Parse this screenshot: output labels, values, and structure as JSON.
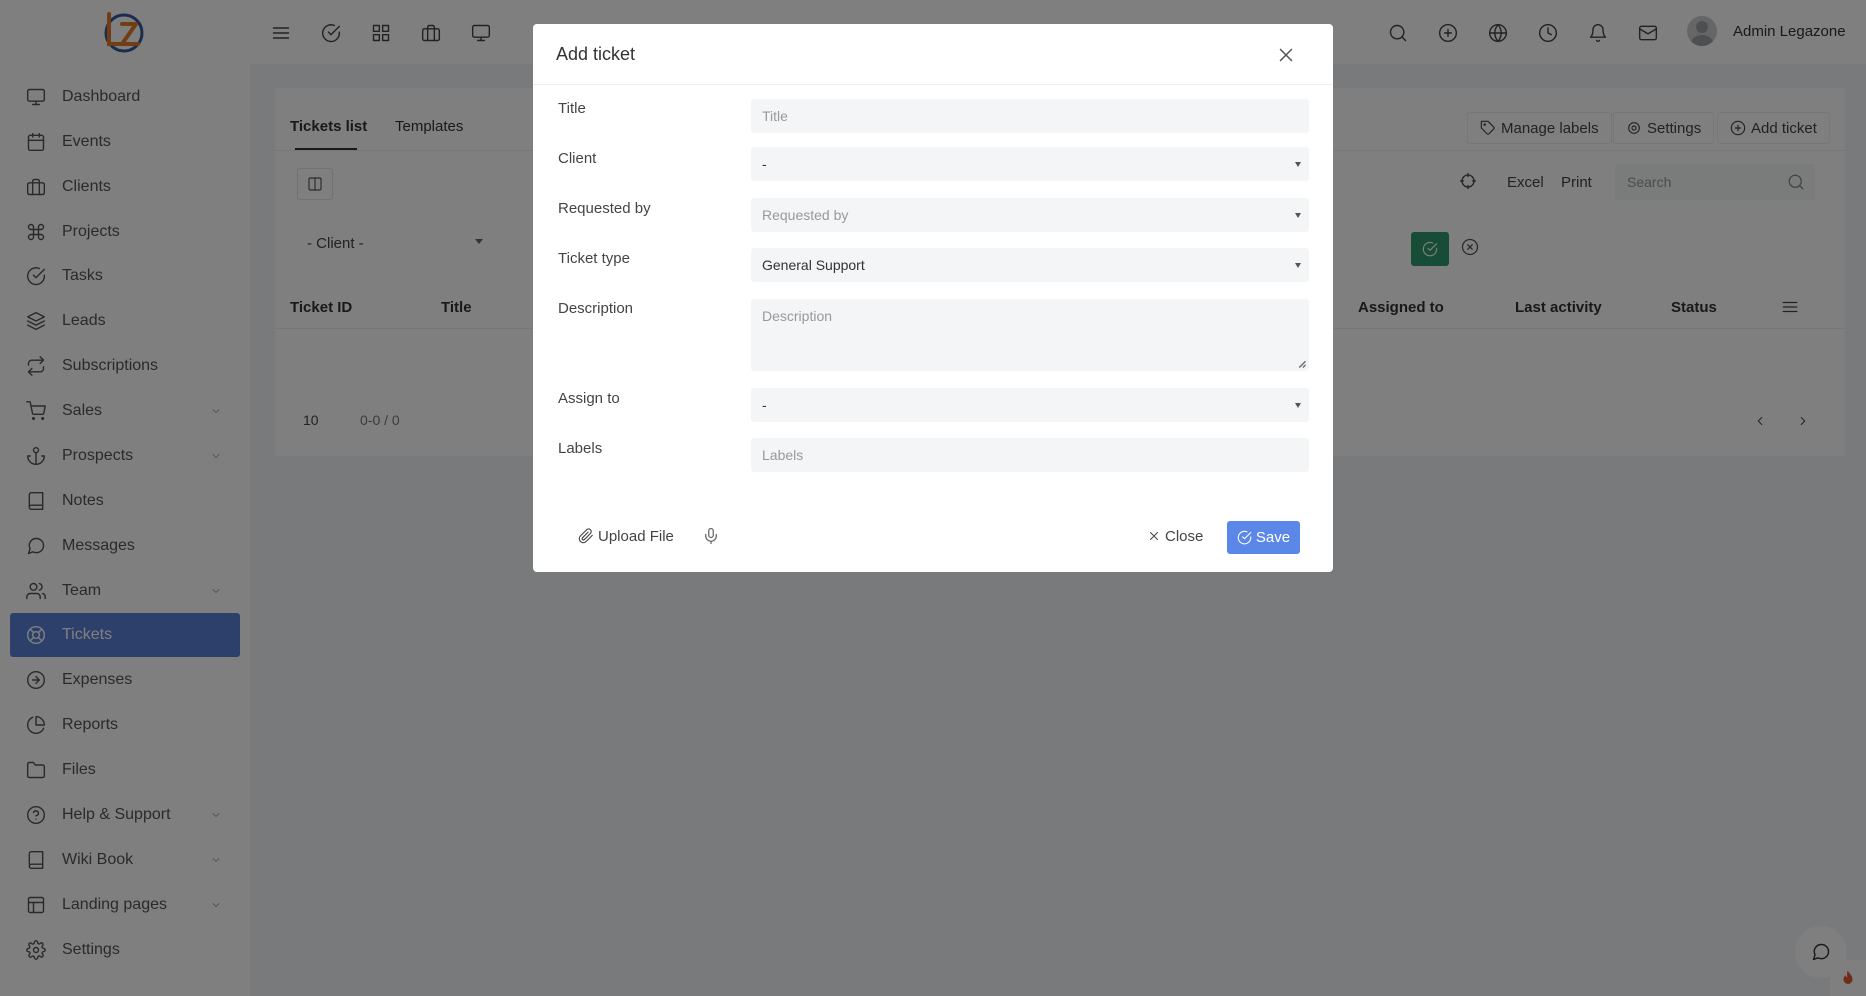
{
  "header": {
    "user_name": "Admin Legazone",
    "icons": [
      "menu-icon",
      "check-circle-icon",
      "grid-icon",
      "briefcase-icon",
      "monitor-icon",
      "search-icon",
      "plus-circle-icon",
      "globe-icon",
      "clock-icon",
      "bell-icon",
      "mail-icon"
    ]
  },
  "sidebar": {
    "items": [
      {
        "label": "Dashboard",
        "icon": "monitor-icon"
      },
      {
        "label": "Events",
        "icon": "calendar-icon"
      },
      {
        "label": "Clients",
        "icon": "briefcase-icon"
      },
      {
        "label": "Projects",
        "icon": "command-icon"
      },
      {
        "label": "Tasks",
        "icon": "check-circle-icon"
      },
      {
        "label": "Leads",
        "icon": "layers-icon"
      },
      {
        "label": "Subscriptions",
        "icon": "repeat-icon"
      },
      {
        "label": "Sales",
        "icon": "cart-icon"
      },
      {
        "label": "Prospects",
        "icon": "anchor-icon"
      },
      {
        "label": "Notes",
        "icon": "book-icon"
      },
      {
        "label": "Messages",
        "icon": "message-icon"
      },
      {
        "label": "Team",
        "icon": "users-icon"
      },
      {
        "label": "Tickets",
        "icon": "lifebuoy-icon"
      },
      {
        "label": "Expenses",
        "icon": "arrow-circle-icon"
      },
      {
        "label": "Reports",
        "icon": "pie-chart-icon"
      },
      {
        "label": "Files",
        "icon": "folder-icon"
      },
      {
        "label": "Help & Support",
        "icon": "help-circle-icon"
      },
      {
        "label": "Wiki Book",
        "icon": "book-icon"
      },
      {
        "label": "Landing pages",
        "icon": "layout-icon"
      },
      {
        "label": "Settings",
        "icon": "gear-icon"
      }
    ],
    "active": "Tickets"
  },
  "main": {
    "tabs": [
      "Tickets list",
      "Templates"
    ],
    "actions": {
      "manage_labels": "Manage labels",
      "settings": "Settings",
      "add_ticket": "Add ticket"
    },
    "toolbar": {
      "excel": "Excel",
      "print": "Print",
      "search_placeholder": "Search"
    },
    "filter_client": "- Client -",
    "columns": [
      "Ticket ID",
      "Title",
      "Assigned to",
      "Last activity",
      "Status"
    ],
    "page_size": "10",
    "page_info": "0-0 / 0"
  },
  "modal": {
    "title": "Add ticket",
    "fields": {
      "title": {
        "label": "Title",
        "placeholder": "Title"
      },
      "client": {
        "label": "Client",
        "value": "-"
      },
      "requested_by": {
        "label": "Requested by",
        "placeholder": "Requested by"
      },
      "ticket_type": {
        "label": "Ticket type",
        "value": "General Support"
      },
      "description": {
        "label": "Description",
        "placeholder": "Description"
      },
      "assign_to": {
        "label": "Assign to",
        "value": "-"
      },
      "labels": {
        "label": "Labels",
        "placeholder": "Labels"
      }
    },
    "upload_label": "Upload File",
    "close_label": "Close",
    "save_label": "Save"
  },
  "colors": {
    "accent": "#5a87e8",
    "sidebar_active": "#5a7fd6",
    "success": "#2e9b6d"
  }
}
